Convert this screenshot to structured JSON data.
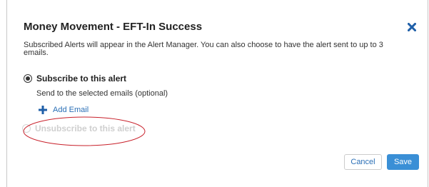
{
  "dialog": {
    "title": "Money Movement - EFT-In Success",
    "close_icon": "close-x-icon",
    "description": "Subscribed Alerts will appear in the Alert Manager. You can also choose to have the alert sent to up to 3 emails."
  },
  "options": {
    "subscribe": {
      "label": "Subscribe to this alert",
      "selected": true,
      "sub_text": "Send to the selected emails (optional)",
      "add_email_label": "Add Email",
      "add_email_icon": "plus-icon"
    },
    "unsubscribe": {
      "label": "Unsubscribe to this alert",
      "selected": false,
      "disabled": true
    }
  },
  "footer": {
    "cancel_label": "Cancel",
    "save_label": "Save"
  },
  "colors": {
    "accent": "#3a8fd6",
    "link": "#2a6fb6",
    "close_icon": "#1f5fa8",
    "annotation": "#c8202a",
    "disabled_text": "#cfcfcf"
  }
}
